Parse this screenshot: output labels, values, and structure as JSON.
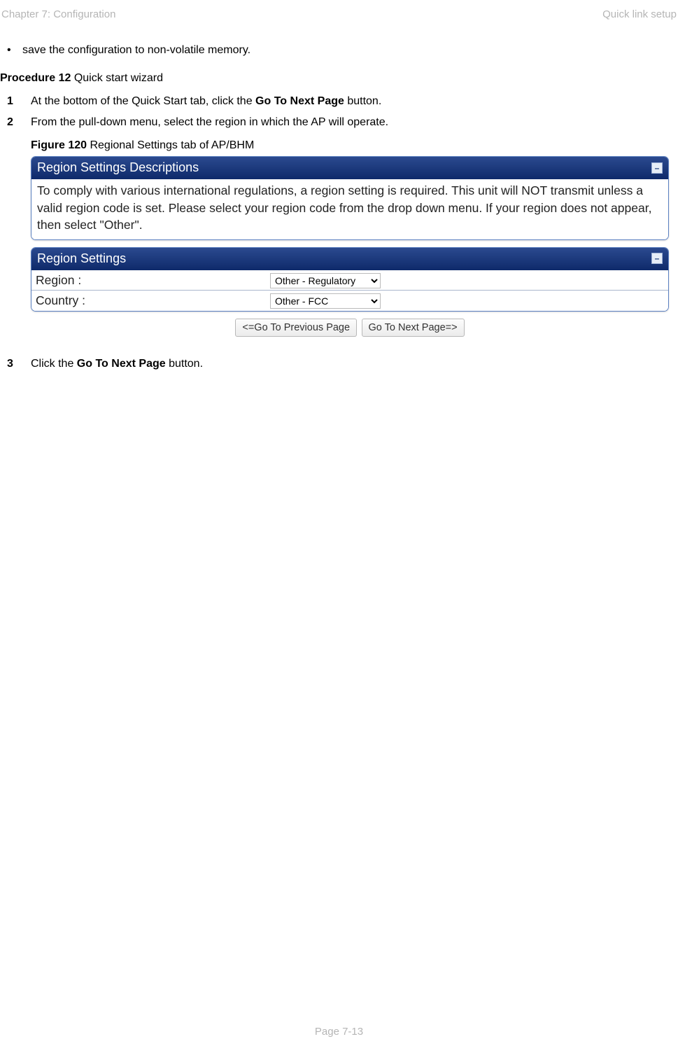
{
  "header": {
    "left": "Chapter 7:  Configuration",
    "right": "Quick link setup"
  },
  "bullet_text": "save the configuration to non-volatile memory.",
  "procedure": {
    "label_bold": "Procedure 12",
    "label_rest": " Quick start wizard"
  },
  "step1": {
    "num": "1",
    "pre": "At the bottom of the Quick Start tab, click the ",
    "bold": "Go To Next Page",
    "post": " button."
  },
  "step2": {
    "num": "2",
    "line": "From the pull-down menu, select the region in which the AP will operate.",
    "fig_bold": "Figure 120",
    "fig_rest": " Regional Settings tab of AP/BHM"
  },
  "panel1": {
    "title": "Region Settings Descriptions",
    "body": "To comply with various international regulations, a region setting is required. This unit will NOT transmit unless a valid region code is set. Please select your region code from the drop down menu. If your region does not appear, then select \"Other\"."
  },
  "panel2": {
    "title": "Region Settings",
    "rows": [
      {
        "label": "Region :",
        "value": "Other - Regulatory"
      },
      {
        "label": "Country :",
        "value": "Other - FCC"
      }
    ]
  },
  "nav": {
    "prev": "<=Go To Previous Page",
    "next": "Go To Next Page=>"
  },
  "step3": {
    "num": "3",
    "pre": "Click the ",
    "bold": "Go To Next Page",
    "post": " button."
  },
  "footer": "Page 7-13",
  "collapse_glyph": "–"
}
